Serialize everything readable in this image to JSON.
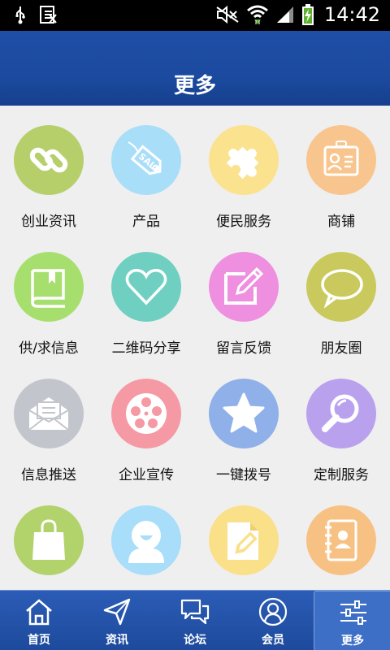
{
  "status_bar": {
    "time": "14:42",
    "icons": [
      "usb-icon",
      "notification-icon",
      "mute-icon",
      "wifi-icon",
      "signal-icon",
      "battery-charging-icon"
    ]
  },
  "header": {
    "title": "更多"
  },
  "grid": {
    "items": [
      {
        "label": "创业资讯",
        "icon": "link-icon",
        "color": "#b6cf6b"
      },
      {
        "label": "产品",
        "icon": "sale-tag-icon",
        "color": "#a9def9"
      },
      {
        "label": "便民服务",
        "icon": "puzzle-icon",
        "color": "#fbe28f"
      },
      {
        "label": "商铺",
        "icon": "id-card-icon",
        "color": "#f8c58e"
      },
      {
        "label": "供/求信息",
        "icon": "book-icon",
        "color": "#a7df6e"
      },
      {
        "label": "二维码分享",
        "icon": "heart-icon",
        "color": "#6fd0c1"
      },
      {
        "label": "留言反馈",
        "icon": "edit-icon",
        "color": "#ee8fe0"
      },
      {
        "label": "朋友圈",
        "icon": "speech-bubble-icon",
        "color": "#cac95d"
      },
      {
        "label": "信息推送",
        "icon": "envelope-icon",
        "color": "#c2c5cb"
      },
      {
        "label": "企业宣传",
        "icon": "film-reel-icon",
        "color": "#f59aa4"
      },
      {
        "label": "一键拨号",
        "icon": "star-icon",
        "color": "#8fb0e8"
      },
      {
        "label": "定制服务",
        "icon": "magnifier-icon",
        "color": "#b9a1ee"
      },
      {
        "label": "",
        "icon": "shopping-bag-icon",
        "color": "#b2d36c"
      },
      {
        "label": "",
        "icon": "user-smile-icon",
        "color": "#a8def9"
      },
      {
        "label": "",
        "icon": "document-pencil-icon",
        "color": "#fbe08a"
      },
      {
        "label": "",
        "icon": "contact-book-icon",
        "color": "#f8c184"
      }
    ]
  },
  "bottom_nav": {
    "active_index": 4,
    "items": [
      {
        "label": "首页",
        "icon": "home-icon"
      },
      {
        "label": "资讯",
        "icon": "send-icon"
      },
      {
        "label": "论坛",
        "icon": "chat-bubbles-icon"
      },
      {
        "label": "会员",
        "icon": "user-circle-icon"
      },
      {
        "label": "更多",
        "icon": "sliders-icon"
      }
    ]
  }
}
